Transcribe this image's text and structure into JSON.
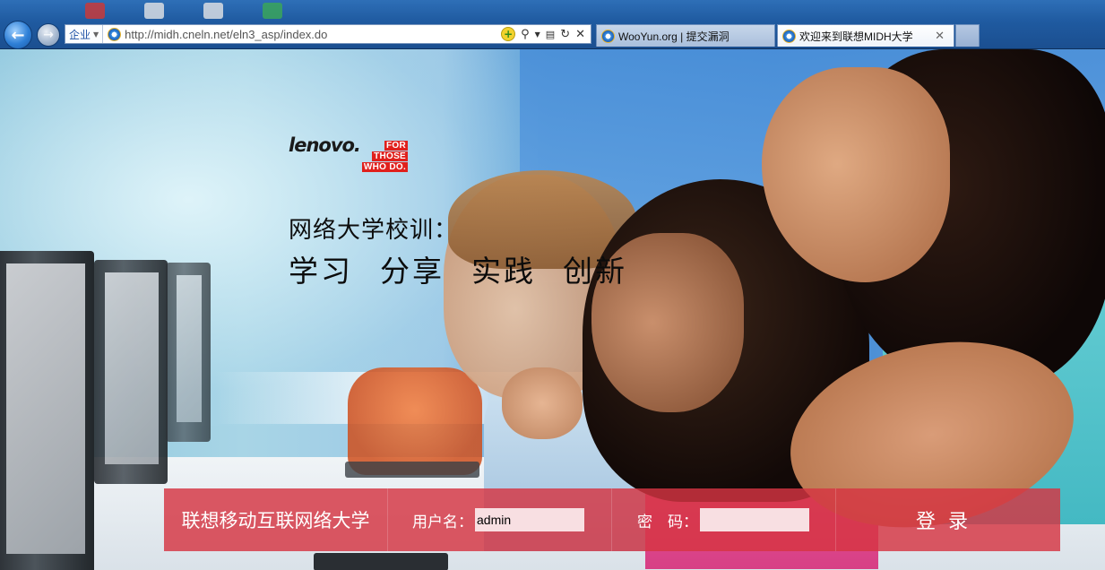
{
  "browser": {
    "zone_label": "企业",
    "url": "http://midh.cneln.net/eln3_asp/index.do",
    "tabs": [
      {
        "label": "WooYun.org | 提交漏洞",
        "active": false
      },
      {
        "label": "欢迎来到联想MIDH大学",
        "active": true
      }
    ],
    "close_glyph": "✕",
    "back_glyph": "←",
    "forward_glyph": "→"
  },
  "page": {
    "logo": {
      "word": "lenovo.",
      "tag_lines": [
        "FOR",
        "THOSE",
        "WHO DO."
      ],
      "brand_color": "#e0201c"
    },
    "motto_title": "网络大学校训：",
    "motto_words": [
      "学习",
      "分享",
      "实践",
      "创新"
    ],
    "login": {
      "site_name": "联想移动互联网络大学",
      "username_label": "用户名：",
      "username_value": "admin",
      "password_label": "密　码：",
      "password_value": "",
      "submit_label": "登录",
      "bar_color": "#d63442"
    }
  }
}
